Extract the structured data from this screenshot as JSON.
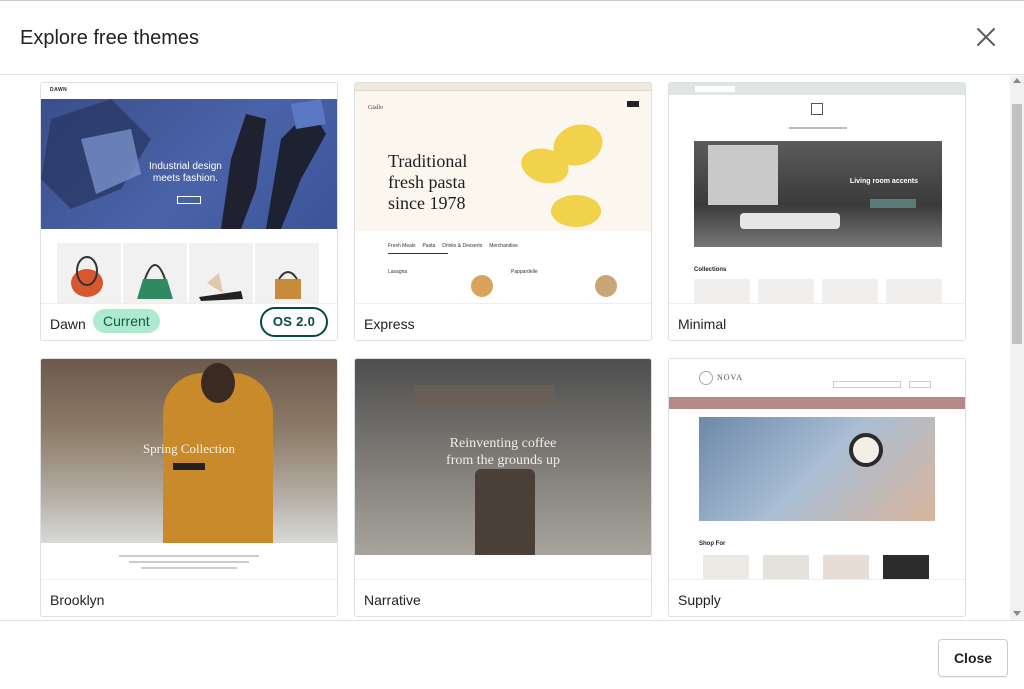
{
  "dialog": {
    "title": "Explore free themes",
    "close_button_label": "Close",
    "close_icon": "close-icon"
  },
  "themes": [
    {
      "name": "Dawn",
      "badge": "Current",
      "tag": "OS 2.0",
      "preview": {
        "logo": "DAWN",
        "hero_text_1": "Industrial design",
        "hero_text_2": "meets fashion."
      }
    },
    {
      "name": "Express",
      "preview": {
        "brand": "Giallo",
        "hero_line_1": "Traditional",
        "hero_line_2": "fresh pasta",
        "hero_line_3": "since 1978",
        "tabs": [
          "Fresh Meals",
          "Pasta",
          "Drinks & Desserts",
          "Merchandise"
        ],
        "items": [
          "Lasagna",
          "Pappardelle"
        ]
      }
    },
    {
      "name": "Minimal",
      "preview": {
        "hero_text": "Living room accents",
        "section_title": "Collections"
      }
    },
    {
      "name": "Brooklyn",
      "preview": {
        "hero_text": "Spring Collection"
      }
    },
    {
      "name": "Narrative",
      "preview": {
        "hero_line_1": "Reinventing coffee",
        "hero_line_2": "from the grounds up"
      }
    },
    {
      "name": "Supply",
      "preview": {
        "logo": "NOVA",
        "section_title": "Shop For"
      }
    }
  ],
  "colors": {
    "badge_bg": "#aee9d1",
    "os_badge_border": "#004c3f"
  }
}
